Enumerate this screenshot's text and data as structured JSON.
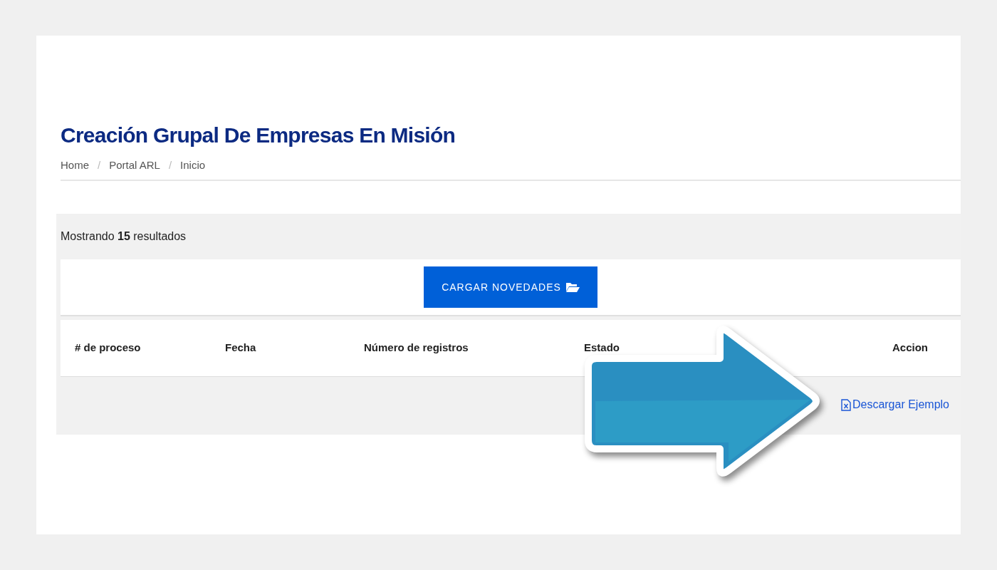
{
  "page": {
    "title": "Creación Grupal De Empresas En Misión"
  },
  "breadcrumb": [
    {
      "label": "Home"
    },
    {
      "separator": "/",
      "label": "Portal ARL"
    },
    {
      "separator": "/",
      "label": "Inicio"
    }
  ],
  "results": {
    "summary": "Mostrando **15** resultados"
  },
  "upload_button": {
    "label": "CARGAR NOVEDADES"
  },
  "table": {
    "columns": [
      "# de proceso",
      "Fecha",
      "Número de registros",
      "Estado",
      "Accion"
    ]
  },
  "download_link": {
    "label": "Descargar Ejemplo"
  }
}
